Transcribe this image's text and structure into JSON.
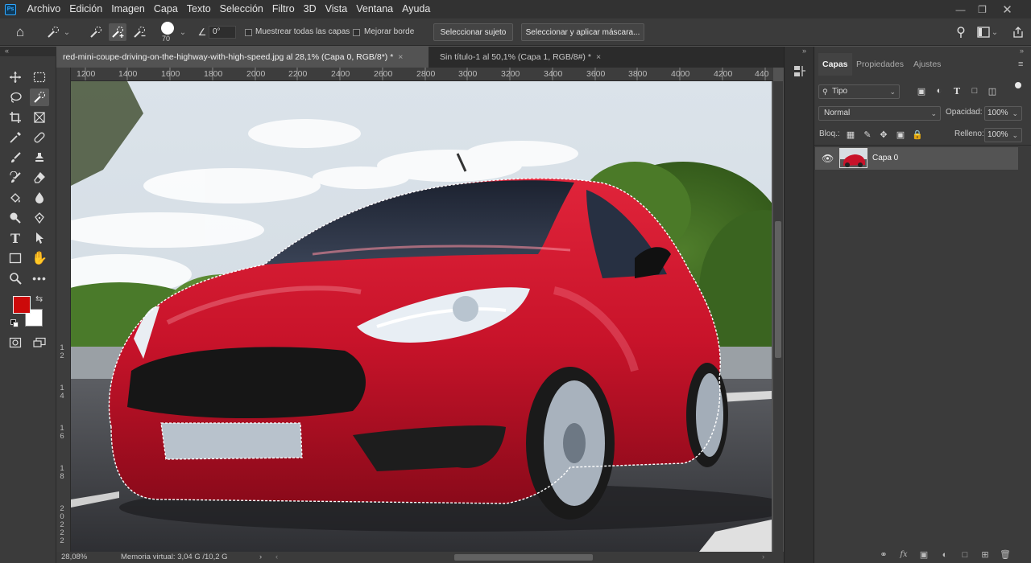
{
  "menubar": {
    "logo": "Ps",
    "items": [
      "Archivo",
      "Edición",
      "Imagen",
      "Capa",
      "Texto",
      "Selección",
      "Filtro",
      "3D",
      "Vista",
      "Ventana",
      "Ayuda"
    ]
  },
  "options": {
    "brush_size": "70",
    "angle": "0°",
    "sample_all_layers": "Muestrear todas las capas",
    "enhance_edge": "Mejorar borde",
    "select_subject": "Seleccionar sujeto",
    "select_mask": "Seleccionar y aplicar máscara..."
  },
  "tabs": [
    {
      "label": "red-mini-coupe-driving-on-the-highway-with-high-speed.jpg al 28,1% (Capa 0, RGB/8*) *",
      "close": "×"
    },
    {
      "label": "Sin título-1 al 50,1% (Capa 1, RGB/8#) *",
      "close": "×"
    }
  ],
  "ruler_h": [
    "1200",
    "1400",
    "1600",
    "1800",
    "2000",
    "2200",
    "2400",
    "2600",
    "2800",
    "3000",
    "3200",
    "3400",
    "3600",
    "3800",
    "4000",
    "4200",
    "440"
  ],
  "ruler_v": [
    "1",
    "2",
    "1",
    "4",
    "1",
    "6",
    "1",
    "8",
    "2",
    "0",
    "2",
    "2",
    "2"
  ],
  "status": {
    "zoom": "28,08%",
    "memory": "Memoria virtual: 3,04 G /10,2 G"
  },
  "panel": {
    "tabs": [
      "Capas",
      "Propiedades",
      "Ajustes"
    ],
    "filter_kind": "Tipo",
    "blend_mode": "Normal",
    "opacity_label": "Opacidad:",
    "opacity_value": "100%",
    "lock_label": "Bloq.:",
    "fill_label": "Relleno:",
    "fill_value": "100%",
    "layer_name": "Capa 0"
  },
  "colors": {
    "foreground": "#cc0a0a",
    "background": "#ffffff",
    "accent": "#31a8ff"
  }
}
